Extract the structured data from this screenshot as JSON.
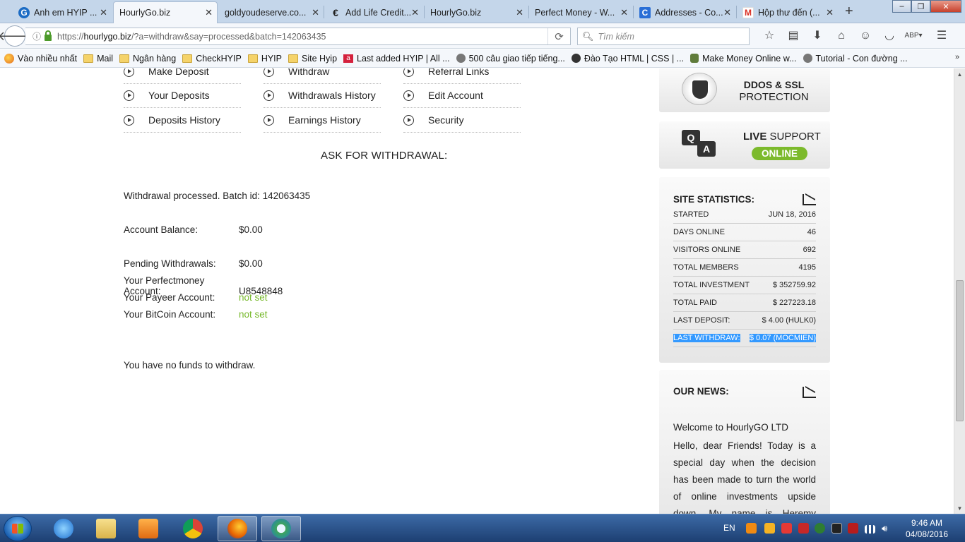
{
  "browser": {
    "tabs": [
      {
        "label": "Anh em HYIP ...",
        "icon": "G",
        "color": "#1c6cc4"
      },
      {
        "label": "HourlyGo.biz",
        "icon": "",
        "color": ""
      },
      {
        "label": "goldyoudeserve.co...",
        "icon": "",
        "color": ""
      },
      {
        "label": "Add Life Credit...",
        "icon": "€",
        "color": "#222"
      },
      {
        "label": "HourlyGo.biz",
        "icon": "",
        "color": ""
      },
      {
        "label": "Perfect Money - W...",
        "icon": "",
        "color": ""
      },
      {
        "label": "Addresses - Co...",
        "icon": "C",
        "color": "#2a6fd6"
      },
      {
        "label": "Hộp thư đến (...",
        "icon": "M",
        "color": "#d93025"
      }
    ],
    "url_prefix": "https://",
    "url_host": "hourlygo.biz",
    "url_path": "/?a=withdraw&say=processed&batch=142063435",
    "search_placeholder": "Tìm kiếm",
    "bookmarks": [
      {
        "label": "Vào nhiều nhất",
        "icon": "flame"
      },
      {
        "label": "Mail",
        "icon": "folder"
      },
      {
        "label": "Ngân hàng",
        "icon": "folder"
      },
      {
        "label": "CheckHYIP",
        "icon": "folder"
      },
      {
        "label": "HYIP",
        "icon": "folder"
      },
      {
        "label": "Site Hyip",
        "icon": "folder"
      },
      {
        "label": "Last added HYIP | All ...",
        "icon": "red"
      },
      {
        "label": "500 câu giao tiếp tiếng...",
        "icon": "globe"
      },
      {
        "label": "Đào Tạo HTML | CSS | ...",
        "icon": "hyip"
      },
      {
        "label": "Make Money Online w...",
        "icon": "money"
      },
      {
        "label": "Tutorial - Con đường ...",
        "icon": "globe"
      }
    ]
  },
  "menu": {
    "items": [
      [
        "Make Deposit",
        "Withdraw",
        "Referral Links"
      ],
      [
        "Your Deposits",
        "Withdrawals History",
        "Edit Account"
      ],
      [
        "Deposits History",
        "Earnings History",
        "Security"
      ]
    ]
  },
  "withdraw": {
    "heading": "ASK FOR WITHDRAWAL:",
    "processed": "Withdrawal processed. Batch id: 142063435",
    "balance_label": "Account Balance:",
    "balance_value": "$0.00",
    "pending_label": "Pending Withdrawals:",
    "pending_value": "$0.00",
    "pm_label": "Your Perfectmoney Account:",
    "pm_value": "U8548848",
    "payeer_label": "Your Payeer Account:",
    "payeer_value": "not set",
    "btc_label": "Your BitCoin Account:",
    "btc_value": "not set",
    "no_funds": "You have no funds to withdraw."
  },
  "sidebar": {
    "ddos_line1": "DDOS & SSL",
    "ddos_line2": "PROTECTION",
    "live_bold": "LIVE",
    "live_rest": " SUPPORT",
    "online": "ONLINE",
    "stats_title": "SITE STATISTICS:",
    "stats": [
      {
        "label": "STARTED",
        "value": "JUN 18, 2016"
      },
      {
        "label": "DAYS ONLINE",
        "value": "46"
      },
      {
        "label": "VISITORS ONLINE",
        "value": "692"
      },
      {
        "label": "TOTAL MEMBERS",
        "value": "4195"
      },
      {
        "label": "TOTAL INVESTMENT",
        "value": "$ 352759.92"
      },
      {
        "label": "TOTAL PAID",
        "value": "$ 227223.18"
      },
      {
        "label": "LAST DEPOSIT:",
        "value": "$ 4.00 (HULK0)"
      },
      {
        "label": "LAST WITHDRAW:",
        "value": "$ 0.07 (MOCMIEN)"
      }
    ],
    "news_title": "OUR NEWS:",
    "news_headline": "Welcome to HourlyGO LTD",
    "news_body": "Hello, dear Friends! Today is a special day when the decision has been made to turn the world of online investments upside down. My name is Heremy Rapman and I"
  },
  "taskbar": {
    "lang": "EN",
    "time": "9:46 AM",
    "date": "04/08/2016"
  }
}
